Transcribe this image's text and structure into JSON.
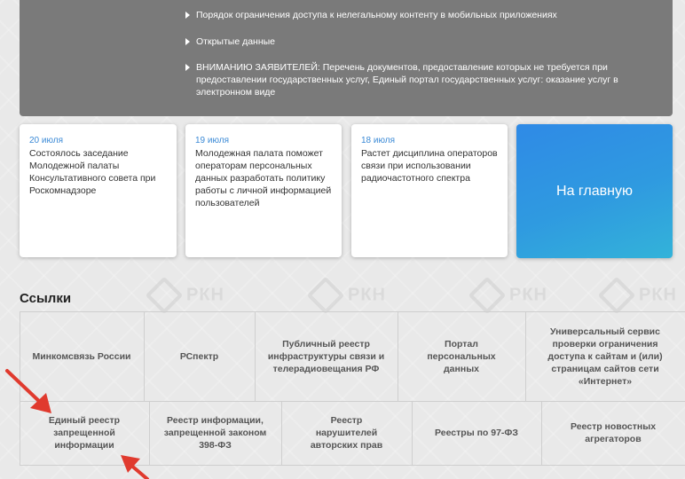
{
  "watermark_text": "РКН",
  "top_links": [
    "Порядок ограничения доступа к нелегальному контенту в мобильных приложениях",
    "Открытые данные",
    "ВНИМАНИЮ ЗАЯВИТЕЛЕЙ: Перечень документов, предоставление которых не требуется при предоставлении государственных услуг, Единый портал государственных услуг: оказание услуг в электронном виде"
  ],
  "news": [
    {
      "date": "20 июля",
      "text": "Состоялось заседание Молодежной палаты Консультативного совета при Роскомнадзоре"
    },
    {
      "date": "19 июля",
      "text": "Молодежная палата поможет операторам персональных данных разработать политику работы с личной информацией пользователей"
    },
    {
      "date": "18 июля",
      "text": "Растет дисциплина операторов связи при использовании радиочастотного спектра"
    }
  ],
  "home_button": "На главную",
  "links_title": "Ссылки",
  "links_row1": [
    "Минкомсвязь России",
    "РСпектр",
    "Публичный реестр инфраструктуры связи и телерадиовещания РФ",
    "Портал персональных данных",
    "Универсальный сервис проверки ограничения доступа к сайтам и (или) страницам сайтов сети «Интернет»"
  ],
  "links_row2": [
    "Единый реестр запрещенной информации",
    "Реестр информации, запрещенной законом 398-ФЗ",
    "Реестр нарушителей авторских прав",
    "Реестры по 97-ФЗ",
    "Реестр новостных агрегаторов"
  ],
  "colors": {
    "top_panel": "#7a7a7a",
    "date_blue": "#3b8ad6",
    "home_button": "#2f8ae6",
    "arrow_red": "#e03a2e"
  }
}
